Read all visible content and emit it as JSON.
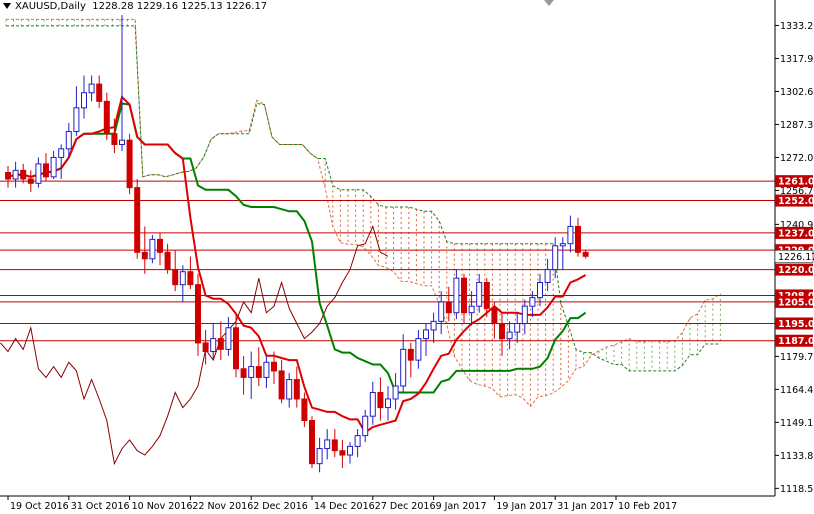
{
  "header": {
    "symbol": "XAUUSD,Daily",
    "ohlc": "1228.28 1229.16 1225.13 1226.17"
  },
  "colors": {
    "bull_candle": "#2020c8",
    "bear_candle": "#d00000",
    "tenkan": "#e00000",
    "kijun": "#008000",
    "chikou": "#8b0000",
    "span_a": "#e07040",
    "span_b": "#208020",
    "level_line": "#c00000",
    "label_bg": "#c00000",
    "label_text": "#ffffff"
  },
  "chart_data": {
    "type": "candlestick",
    "symbol": "XAUUSD",
    "timeframe": "Daily",
    "ylim": [
      1115.0,
      1345.0
    ],
    "y_ticks": [
      1333.2,
      1317.9,
      1302.6,
      1287.3,
      1272.0,
      1256.7,
      1240.95,
      1226.17,
      1210.35,
      1195.0,
      1179.75,
      1164.45,
      1149.15,
      1133.85,
      1118.55
    ],
    "y_tick_labels": [
      "1333.20",
      "1317.90",
      "1302.60",
      "1287.30",
      "1272.00",
      "1256.70",
      "1240.95",
      "1226.17",
      "",
      "",
      "1179.75",
      "1164.45",
      "1149.15",
      "1133.85",
      "1118.55"
    ],
    "x_tick_labels": [
      {
        "label": "19 Oct 2016",
        "bar": 0
      },
      {
        "label": "31 Oct 2016",
        "bar": 8
      },
      {
        "label": "10 Nov 2016",
        "bar": 16
      },
      {
        "label": "22 Nov 2016",
        "bar": 24
      },
      {
        "label": "2 Dec 2016",
        "bar": 32
      },
      {
        "label": "14 Dec 2016",
        "bar": 40
      },
      {
        "label": "27 Dec 2016",
        "bar": 48
      },
      {
        "label": "9 Jan 2017",
        "bar": 56
      },
      {
        "label": "19 Jan 2017",
        "bar": 64
      },
      {
        "label": "31 Jan 2017",
        "bar": 72
      },
      {
        "label": "10 Feb 2017",
        "bar": 80
      }
    ],
    "horizontal_levels": [
      {
        "price": 1261.0,
        "label": "1261.00"
      },
      {
        "price": 1252.0,
        "label": "1252.00"
      },
      {
        "price": 1237.0,
        "label": "1237.00"
      },
      {
        "price": 1229.0,
        "label": "1229.00"
      },
      {
        "price": 1220.0,
        "label": "1220.00"
      },
      {
        "price": 1208.0,
        "label": "1208.00"
      },
      {
        "price": 1205.0,
        "label": "1205.00"
      },
      {
        "price": 1195.0,
        "label": "1195.00"
      },
      {
        "price": 1187.0,
        "label": "1187.00"
      }
    ],
    "candles": [
      [
        1265,
        1268,
        1258,
        1262
      ],
      [
        1262,
        1270,
        1258,
        1266
      ],
      [
        1266,
        1269,
        1260,
        1262
      ],
      [
        1262,
        1266,
        1256,
        1260
      ],
      [
        1260,
        1272,
        1258,
        1269
      ],
      [
        1269,
        1274,
        1261,
        1263
      ],
      [
        1263,
        1275,
        1262,
        1272
      ],
      [
        1272,
        1278,
        1262,
        1276
      ],
      [
        1276,
        1288,
        1272,
        1284
      ],
      [
        1284,
        1305,
        1282,
        1295
      ],
      [
        1295,
        1310,
        1290,
        1302
      ],
      [
        1302,
        1310,
        1298,
        1306
      ],
      [
        1306,
        1310,
        1295,
        1298
      ],
      [
        1298,
        1302,
        1280,
        1283
      ],
      [
        1283,
        1290,
        1274,
        1278
      ],
      [
        1278,
        1338,
        1275,
        1280
      ],
      [
        1280,
        1283,
        1255,
        1258
      ],
      [
        1258,
        1262,
        1225,
        1228
      ],
      [
        1228,
        1240,
        1218,
        1225
      ],
      [
        1225,
        1236,
        1223,
        1234
      ],
      [
        1234,
        1237,
        1222,
        1228
      ],
      [
        1228,
        1232,
        1218,
        1220
      ],
      [
        1220,
        1229,
        1210,
        1213
      ],
      [
        1213,
        1222,
        1205,
        1219
      ],
      [
        1219,
        1226,
        1211,
        1213
      ],
      [
        1213,
        1218,
        1180,
        1186
      ],
      [
        1186,
        1192,
        1176,
        1182
      ],
      [
        1182,
        1195,
        1178,
        1188
      ],
      [
        1188,
        1196,
        1178,
        1183
      ],
      [
        1183,
        1198,
        1180,
        1193
      ],
      [
        1193,
        1200,
        1170,
        1174
      ],
      [
        1174,
        1180,
        1162,
        1170
      ],
      [
        1170,
        1182,
        1160,
        1175
      ],
      [
        1175,
        1184,
        1166,
        1170
      ],
      [
        1170,
        1180,
        1165,
        1177
      ],
      [
        1177,
        1182,
        1167,
        1173
      ],
      [
        1173,
        1178,
        1158,
        1160
      ],
      [
        1160,
        1172,
        1156,
        1169
      ],
      [
        1169,
        1175,
        1156,
        1160
      ],
      [
        1160,
        1163,
        1147,
        1150
      ],
      [
        1150,
        1152,
        1128,
        1130
      ],
      [
        1130,
        1142,
        1126,
        1137
      ],
      [
        1137,
        1146,
        1132,
        1141
      ],
      [
        1141,
        1146,
        1133,
        1136
      ],
      [
        1136,
        1141,
        1128,
        1134
      ],
      [
        1134,
        1140,
        1130,
        1138
      ],
      [
        1138,
        1146,
        1133,
        1143
      ],
      [
        1143,
        1155,
        1140,
        1152
      ],
      [
        1152,
        1168,
        1148,
        1163
      ],
      [
        1163,
        1170,
        1150,
        1156
      ],
      [
        1156,
        1166,
        1150,
        1160
      ],
      [
        1160,
        1172,
        1155,
        1166
      ],
      [
        1166,
        1190,
        1163,
        1183
      ],
      [
        1183,
        1186,
        1170,
        1178
      ],
      [
        1178,
        1192,
        1174,
        1188
      ],
      [
        1188,
        1195,
        1180,
        1192
      ],
      [
        1192,
        1200,
        1186,
        1196
      ],
      [
        1196,
        1210,
        1190,
        1205
      ],
      [
        1205,
        1212,
        1196,
        1200
      ],
      [
        1200,
        1220,
        1197,
        1216
      ],
      [
        1216,
        1218,
        1195,
        1200
      ],
      [
        1200,
        1210,
        1194,
        1203
      ],
      [
        1203,
        1218,
        1200,
        1214
      ],
      [
        1214,
        1216,
        1198,
        1202
      ],
      [
        1202,
        1205,
        1188,
        1195
      ],
      [
        1195,
        1200,
        1180,
        1188
      ],
      [
        1188,
        1196,
        1183,
        1191
      ],
      [
        1191,
        1200,
        1186,
        1195
      ],
      [
        1195,
        1206,
        1190,
        1203
      ],
      [
        1203,
        1210,
        1198,
        1207
      ],
      [
        1207,
        1218,
        1203,
        1214
      ],
      [
        1214,
        1225,
        1210,
        1220
      ],
      [
        1220,
        1235,
        1216,
        1231
      ],
      [
        1231,
        1235,
        1220,
        1232
      ],
      [
        1232,
        1245,
        1228,
        1240
      ],
      [
        1240,
        1244,
        1226,
        1228
      ],
      [
        1228,
        1229.16,
        1225.13,
        1226.17
      ]
    ]
  }
}
